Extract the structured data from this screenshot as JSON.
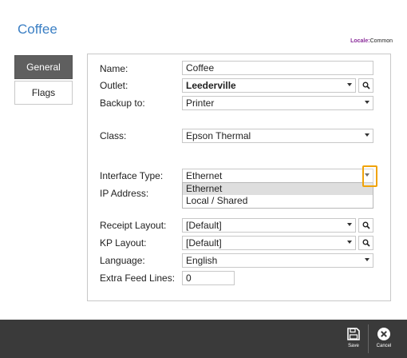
{
  "header": {
    "title": "Coffee",
    "locale_label": "Locale:",
    "locale_value": "Common"
  },
  "tabs": [
    {
      "label": "General"
    },
    {
      "label": "Flags"
    }
  ],
  "form": {
    "name": {
      "label": "Name:",
      "value": "Coffee"
    },
    "outlet": {
      "label": "Outlet:",
      "value": "Leederville"
    },
    "backup_to": {
      "label": "Backup to:",
      "value": "Printer"
    },
    "class": {
      "label": "Class:",
      "value": "Epson Thermal"
    },
    "interface_type": {
      "label": "Interface Type:",
      "value": "Ethernet"
    },
    "ip_address": {
      "label": "IP Address:"
    },
    "receipt_layout": {
      "label": "Receipt Layout:",
      "value": "[Default]"
    },
    "kp_layout": {
      "label": "KP Layout:",
      "value": "[Default]"
    },
    "language": {
      "label": "Language:",
      "value": "English"
    },
    "extra_feed_lines": {
      "label": "Extra Feed Lines:",
      "value": "0"
    }
  },
  "interface_dropdown": {
    "options": [
      "Ethernet",
      "Local / Shared"
    ],
    "selected": "Ethernet"
  },
  "footer": {
    "save_label": "Save",
    "cancel_label": "Cancel"
  },
  "colors": {
    "title": "#3b7fc4",
    "locale_label": "#8a2c9a",
    "highlight": "#f0a30a",
    "footer_bg": "#3a3a3a"
  }
}
